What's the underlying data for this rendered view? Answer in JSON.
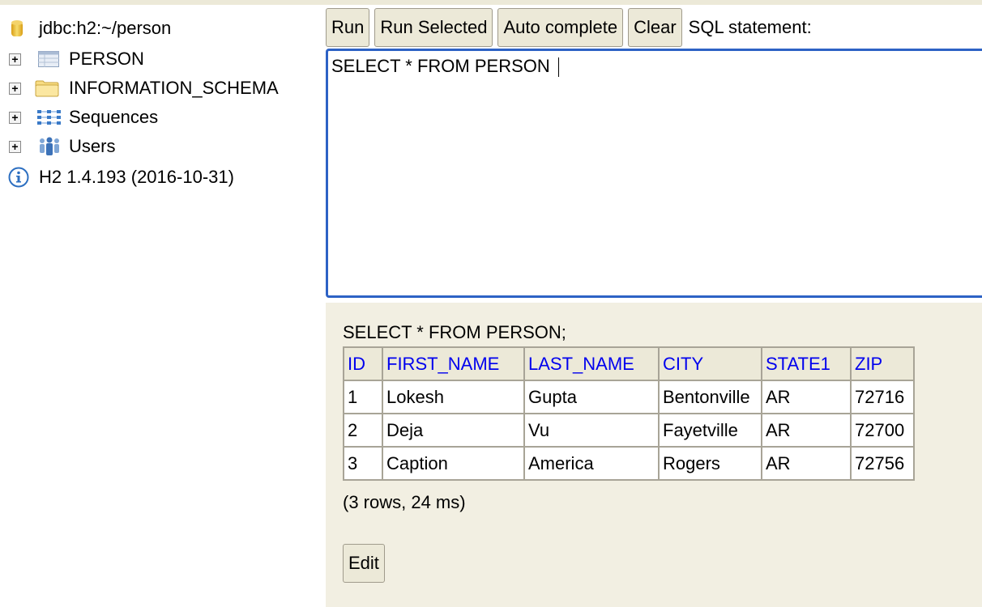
{
  "sidebar": {
    "connection": "jdbc:h2:~/person",
    "items": [
      {
        "label": "PERSON",
        "icon": "table-icon"
      },
      {
        "label": "INFORMATION_SCHEMA",
        "icon": "folder-icon"
      },
      {
        "label": "Sequences",
        "icon": "sequences-icon"
      },
      {
        "label": "Users",
        "icon": "users-icon"
      }
    ],
    "version": "H2 1.4.193 (2016-10-31)"
  },
  "toolbar": {
    "run": "Run",
    "run_selected": "Run Selected",
    "auto_complete": "Auto complete",
    "clear": "Clear",
    "sql_label": "SQL statement:"
  },
  "editor": {
    "value": "SELECT * FROM PERSON "
  },
  "result": {
    "statement": "SELECT * FROM PERSON;",
    "columns": [
      "ID",
      "FIRST_NAME",
      "LAST_NAME",
      "CITY",
      "STATE1",
      "ZIP"
    ],
    "rows": [
      [
        "1",
        "Lokesh",
        "Gupta",
        "Bentonville",
        "AR",
        "72716"
      ],
      [
        "2",
        "Deja",
        "Vu",
        "Fayetville",
        "AR",
        "72700"
      ],
      [
        "3",
        "Caption",
        "America",
        "Rogers",
        "AR",
        "72756"
      ]
    ],
    "summary": "(3 rows, 24 ms)",
    "edit_label": "Edit"
  },
  "colors": {
    "accent": "#2d62c5",
    "header_link": "#0000ee",
    "panel_bg": "#f2efe2",
    "button_bg": "#ece9d8"
  }
}
